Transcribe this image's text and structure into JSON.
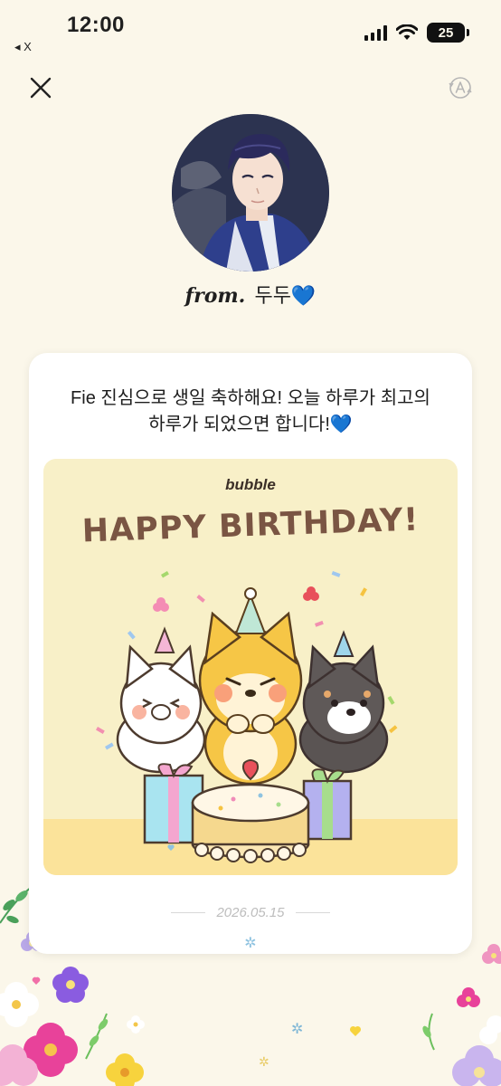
{
  "status_bar": {
    "time": "12:00",
    "back_app": "◂ X",
    "battery": "25"
  },
  "header": {
    "close_icon": "close-icon",
    "translate_icon": "translate-icon"
  },
  "sender": {
    "prefix": "from.",
    "name": "두두💙"
  },
  "card": {
    "message_line1": "Fie 진심으로 생일 축하해요! 오늘 하루가 최고의",
    "message_line2": "하루가 되었으면 합니다!💙",
    "sticker": {
      "brand": "bubble",
      "title": "HAPPY BIRTHDAY!"
    },
    "date": "2026.05.15"
  },
  "colors": {
    "background": "#fbf7ea",
    "sticker_bg": "#f8f0c8",
    "title_brown": "#7a5543"
  }
}
